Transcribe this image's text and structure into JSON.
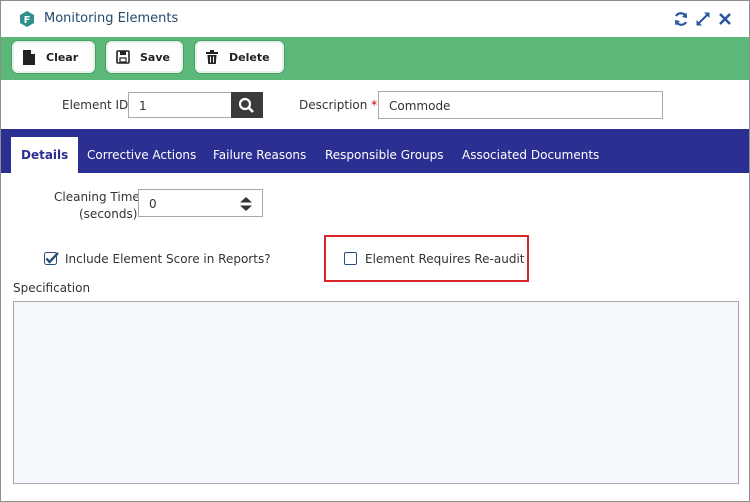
{
  "window": {
    "title": "Monitoring Elements",
    "icons": [
      "app-logo-icon",
      "refresh-icon",
      "expand-icon",
      "close-icon"
    ],
    "accent": "#5cb878"
  },
  "toolbar": {
    "clear_label": "Clear",
    "save_label": "Save",
    "delete_label": "Delete"
  },
  "form": {
    "element_id_label": "Element ID",
    "element_id_value": "1",
    "description_label": "Description",
    "required_mark": "*",
    "description_value": "Commode"
  },
  "tabs": [
    {
      "label": "Details",
      "active": true
    },
    {
      "label": "Corrective Actions"
    },
    {
      "label": "Failure Reasons"
    },
    {
      "label": "Responsible Groups"
    },
    {
      "label": "Associated Documents"
    }
  ],
  "details": {
    "cleaning_time_label_line1": "Cleaning Time",
    "cleaning_time_label_line2": "(seconds)",
    "cleaning_time_value": "0",
    "include_score_label": "Include Element Score in Reports?",
    "include_score_checked": true,
    "requires_reaudit_label": "Element Requires Re-audit",
    "requires_reaudit_checked": false,
    "specification_label": "Specification",
    "specification_value": ""
  },
  "colors": {
    "tab_bar": "#2a2f91",
    "toolbar": "#5cb878",
    "highlight": "#d9262b"
  }
}
